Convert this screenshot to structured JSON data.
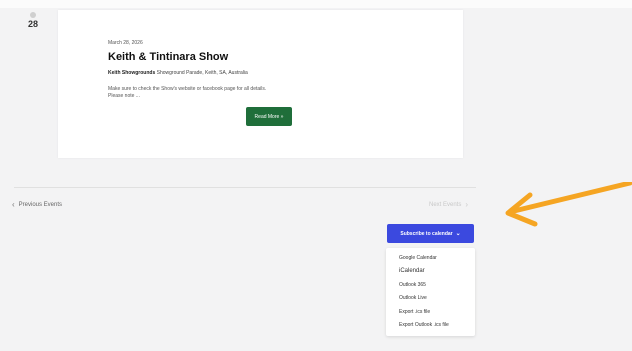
{
  "day": {
    "number": "28"
  },
  "event": {
    "date": "March 28, 2026",
    "title": "Keith & Tintinara Show",
    "venue_name": "Keith Showgrounds",
    "venue_address": "Showground Parade, Keith, SA, Australia",
    "description": "Make sure to check the Show's website or facebook page for all details.",
    "more": "Please note ...",
    "read_more": "Read More »"
  },
  "nav": {
    "previous": "Previous Events",
    "next": "Next Events"
  },
  "subscribe": {
    "label": "Subscribe to calendar",
    "options": [
      "Google Calendar",
      "iCalendar",
      "Outlook 365",
      "Outlook Live",
      "Export .ics file",
      "Export Outlook .ics file"
    ]
  },
  "colors": {
    "read_more_bg": "#1f6e3a",
    "subscribe_bg": "#3b49df",
    "arrow": "#f5a523"
  },
  "icons": {
    "arrow": "annotation-arrow-icon",
    "prev": "chevron-left-icon",
    "next": "chevron-right-icon",
    "dropdown": "chevron-down-icon"
  }
}
